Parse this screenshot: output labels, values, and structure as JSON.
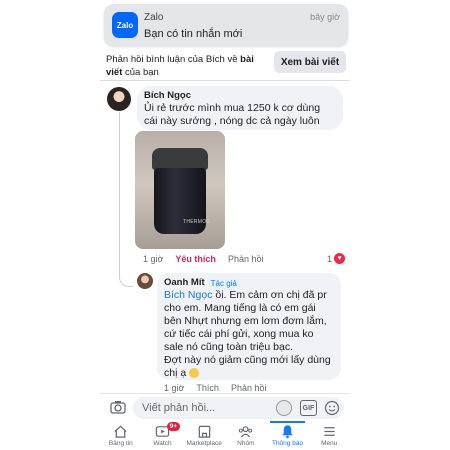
{
  "notification_banner": {
    "logo_text": "Zalo",
    "app_name": "Zalo",
    "message": "Bạn có tin nhắn mới",
    "time": "bây giờ"
  },
  "notice": {
    "text_prefix": "Phản hồi bình luận của Bích về ",
    "text_bold": "bài viết",
    "text_suffix": " của bạn",
    "button_label": "Xem bài viết"
  },
  "comment": {
    "author": "Bích Ngọc",
    "text": "Ủi rẻ trước mình mua 1250 k cơ dùng cái này sướng  , nóng dc cả ngày luôn",
    "photo_brand": "THERMOS",
    "time": "1 giờ",
    "like_label": "Yêu thích",
    "reply_label": "Phản hồi",
    "reaction_count": "1",
    "reaction_icon": "heart-icon"
  },
  "reply": {
    "author": "Oanh Mít",
    "author_badge": "Tác giả",
    "mention": "Bích Ngọc",
    "text": " ồi. Em cảm ơn chị đã pr cho em. Mang tiếng là có em gái bên Nhựt nhưng em lơm đơm lắm, cứ tiếc cái phí gửi, xong mua ko sale nó cũng toàn triệu bạc.",
    "text2": "Đợt này nó giảm cũng mới lấy dùng chị ạ",
    "time": "1 giờ",
    "like_label": "Thích",
    "reply_label": "Phản hồi"
  },
  "comment_input": {
    "placeholder": "Viết phản hồi...",
    "gif_label": "GIF"
  },
  "bottom_nav": {
    "items": [
      {
        "label": "Bảng tin",
        "icon": "home-icon"
      },
      {
        "label": "Watch",
        "icon": "watch-icon",
        "badge": "9+"
      },
      {
        "label": "Marketplace",
        "icon": "marketplace-icon"
      },
      {
        "label": "Nhóm",
        "icon": "groups-icon"
      },
      {
        "label": "Thông báo",
        "icon": "bell-icon",
        "active": true
      },
      {
        "label": "Menu",
        "icon": "menu-icon"
      }
    ]
  },
  "colors": {
    "accent": "#1877f2",
    "liked": "#e0245e",
    "zalo": "#0068ff"
  }
}
